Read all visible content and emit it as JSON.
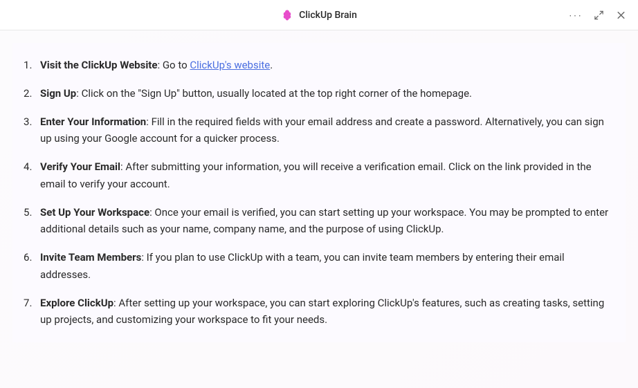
{
  "header": {
    "title": "ClickUp Brain"
  },
  "steps": [
    {
      "title": "Visit the ClickUp Website",
      "prefix": ": Go to ",
      "link": "ClickUp's website",
      "suffix": "."
    },
    {
      "title": "Sign Up",
      "text": ": Click on the \"Sign Up\" button, usually located at the top right corner of the homepage."
    },
    {
      "title": "Enter Your Information",
      "text": ": Fill in the required fields with your email address and create a password. Alternatively, you can sign up using your Google account for a quicker process."
    },
    {
      "title": "Verify Your Email",
      "text": ": After submitting your information, you will receive a verification email. Click on the link provided in the email to verify your account."
    },
    {
      "title": "Set Up Your Workspace",
      "text": ": Once your email is verified, you can start setting up your workspace. You may be prompted to enter additional details such as your name, company name, and the purpose of using ClickUp."
    },
    {
      "title": "Invite Team Members",
      "text": ": If you plan to use ClickUp with a team, you can invite team members by entering their email addresses."
    },
    {
      "title": "Explore ClickUp",
      "text": ": After setting up your workspace, you can start exploring ClickUp's features, such as creating tasks, setting up projects, and customizing your workspace to fit your needs."
    }
  ]
}
